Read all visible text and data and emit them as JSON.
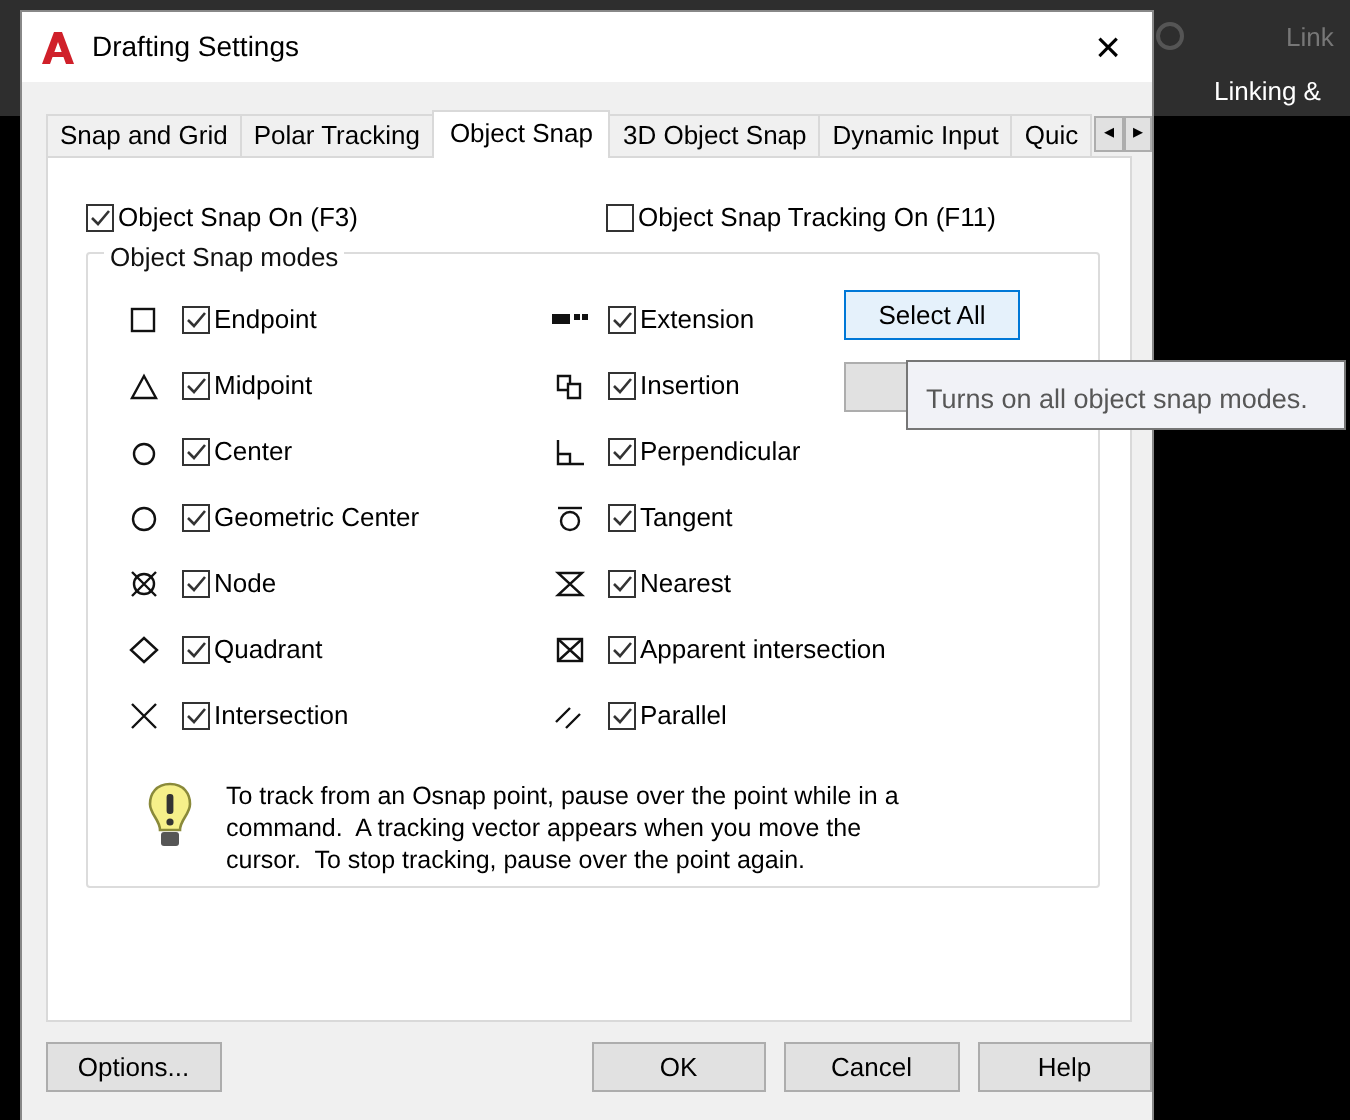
{
  "background": {
    "ribbon_button": "Link",
    "ribbon_label": "Linking &"
  },
  "window": {
    "title": "Drafting Settings",
    "close": "×"
  },
  "tabs": [
    {
      "label": "Snap and Grid",
      "selected": false
    },
    {
      "label": "Polar Tracking",
      "selected": false
    },
    {
      "label": "Object Snap",
      "selected": true
    },
    {
      "label": "3D Object Snap",
      "selected": false
    },
    {
      "label": "Dynamic Input",
      "selected": false
    },
    {
      "label": "Quic",
      "selected": false
    }
  ],
  "tab_scroll": [
    "◂",
    "▸"
  ],
  "object_snap_on": {
    "label": "Object Snap On (F3)",
    "checked": true
  },
  "object_snap_tracking_on": {
    "label": "Object Snap Tracking On (F11)",
    "checked": false
  },
  "modes_group": {
    "title": "Object Snap modes",
    "left_column": [
      {
        "label": "Endpoint",
        "checked": true
      },
      {
        "label": "Midpoint",
        "checked": true
      },
      {
        "label": "Center",
        "checked": true
      },
      {
        "label": "Geometric Center",
        "checked": true
      },
      {
        "label": "Node",
        "checked": true
      },
      {
        "label": "Quadrant",
        "checked": true
      },
      {
        "label": "Intersection",
        "checked": true
      }
    ],
    "right_column": [
      {
        "label": "Extension",
        "checked": true
      },
      {
        "label": "Insertion",
        "checked": true
      },
      {
        "label": "Perpendicular",
        "checked": true
      },
      {
        "label": "Tangent",
        "checked": true
      },
      {
        "label": "Nearest",
        "checked": true
      },
      {
        "label": "Apparent intersection",
        "checked": true
      },
      {
        "label": "Parallel",
        "checked": true
      }
    ],
    "select_all": "Select All",
    "hint": "To track from an Osnap point, pause over the point while in a command.  A tracking vector appears when you move the cursor.  To stop tracking, pause over the point again."
  },
  "tooltip": "Turns on all object snap modes.",
  "buttons": {
    "options": "Options...",
    "ok": "OK",
    "cancel": "Cancel",
    "help": "Help"
  }
}
